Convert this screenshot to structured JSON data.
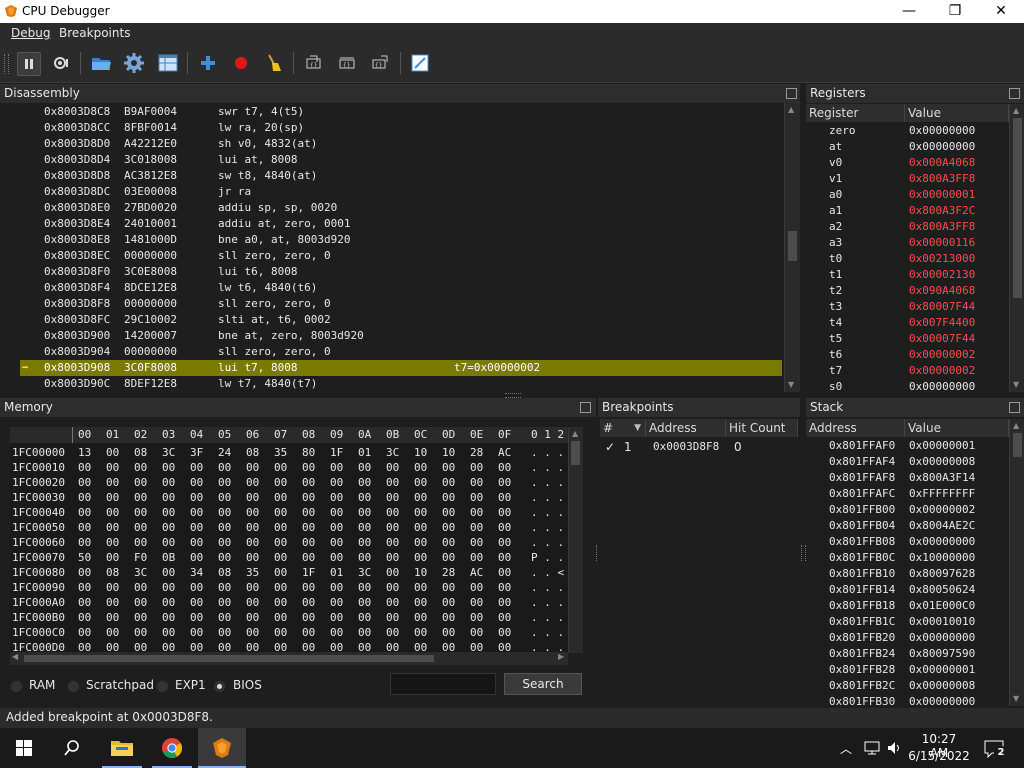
{
  "window": {
    "title": "CPU Debugger",
    "min": "—",
    "max": "❐",
    "close": "✕"
  },
  "menu": {
    "debug": "Debug",
    "breakpoints": "Breakpoints"
  },
  "disassembly": {
    "title": "Disassembly",
    "rows": [
      [
        "0x8003D8C8",
        "B9AF0004",
        "swr t7, 4(t5)",
        ""
      ],
      [
        "0x8003D8CC",
        "8FBF0014",
        "lw ra, 20(sp)",
        ""
      ],
      [
        "0x8003D8D0",
        "A42212E0",
        "sh v0, 4832(at)",
        ""
      ],
      [
        "0x8003D8D4",
        "3C018008",
        "lui at, 8008",
        ""
      ],
      [
        "0x8003D8D8",
        "AC3812E8",
        "sw t8, 4840(at)",
        ""
      ],
      [
        "0x8003D8DC",
        "03E00008",
        "jr ra",
        ""
      ],
      [
        "0x8003D8E0",
        "27BD0020",
        "addiu sp, sp, 0020",
        ""
      ],
      [
        "0x8003D8E4",
        "24010001",
        "addiu at, zero, 0001",
        ""
      ],
      [
        "0x8003D8E8",
        "1481000D",
        "bne a0, at, 8003d920",
        ""
      ],
      [
        "0x8003D8EC",
        "00000000",
        "sll zero, zero, 0",
        ""
      ],
      [
        "0x8003D8F0",
        "3C0E8008",
        "lui t6, 8008",
        ""
      ],
      [
        "0x8003D8F4",
        "8DCE12E8",
        "lw t6, 4840(t6)",
        ""
      ],
      [
        "0x8003D8F8",
        "00000000",
        "sll zero, zero, 0",
        ""
      ],
      [
        "0x8003D8FC",
        "29C10002",
        "slti at, t6, 0002",
        ""
      ],
      [
        "0x8003D900",
        "14200007",
        "bne at, zero, 8003d920",
        ""
      ],
      [
        "0x8003D904",
        "00000000",
        "sll zero, zero, 0",
        ""
      ],
      [
        "0x8003D908",
        "3C0F8008",
        "lui t7, 8008",
        "t7=0x00000002"
      ],
      [
        "0x8003D90C",
        "8DEF12E8",
        "lw t7, 4840(t7)",
        ""
      ]
    ],
    "current_index": 16
  },
  "registers": {
    "title": "Registers",
    "col_register": "Register",
    "col_value": "Value",
    "rows": [
      {
        "name": "zero",
        "value": "0x00000000",
        "changed": false
      },
      {
        "name": "at",
        "value": "0x00000000",
        "changed": false
      },
      {
        "name": "v0",
        "value": "0x000A4068",
        "changed": true
      },
      {
        "name": "v1",
        "value": "0x800A3FF8",
        "changed": true
      },
      {
        "name": "a0",
        "value": "0x00000001",
        "changed": true
      },
      {
        "name": "a1",
        "value": "0x800A3F2C",
        "changed": true
      },
      {
        "name": "a2",
        "value": "0x800A3FF8",
        "changed": true
      },
      {
        "name": "a3",
        "value": "0x00000116",
        "changed": true
      },
      {
        "name": "t0",
        "value": "0x00213000",
        "changed": true
      },
      {
        "name": "t1",
        "value": "0x00002130",
        "changed": true
      },
      {
        "name": "t2",
        "value": "0x090A4068",
        "changed": true
      },
      {
        "name": "t3",
        "value": "0x80007F44",
        "changed": true
      },
      {
        "name": "t4",
        "value": "0x007F4400",
        "changed": true
      },
      {
        "name": "t5",
        "value": "0x00007F44",
        "changed": true
      },
      {
        "name": "t6",
        "value": "0x00000002",
        "changed": true
      },
      {
        "name": "t7",
        "value": "0x00000002",
        "changed": true
      },
      {
        "name": "s0",
        "value": "0x00000000",
        "changed": false
      }
    ]
  },
  "memory": {
    "title": "Memory",
    "col_headers": [
      "00",
      "01",
      "02",
      "03",
      "04",
      "05",
      "06",
      "07",
      "08",
      "09",
      "0A",
      "0B",
      "0C",
      "0D",
      "0E",
      "0F"
    ],
    "ascii_header": "0 1 2",
    "rows": [
      {
        "addr": "1FC00000",
        "bytes": [
          "13",
          "00",
          "08",
          "3C",
          "3F",
          "24",
          "08",
          "35",
          "80",
          "1F",
          "01",
          "3C",
          "10",
          "10",
          "28",
          "AC"
        ],
        "ascii": ". . ."
      },
      {
        "addr": "1FC00010",
        "bytes": [
          "00",
          "00",
          "00",
          "00",
          "00",
          "00",
          "00",
          "00",
          "00",
          "00",
          "00",
          "00",
          "00",
          "00",
          "00",
          "00"
        ],
        "ascii": ". . ."
      },
      {
        "addr": "1FC00020",
        "bytes": [
          "00",
          "00",
          "00",
          "00",
          "00",
          "00",
          "00",
          "00",
          "00",
          "00",
          "00",
          "00",
          "00",
          "00",
          "00",
          "00"
        ],
        "ascii": ". . ."
      },
      {
        "addr": "1FC00030",
        "bytes": [
          "00",
          "00",
          "00",
          "00",
          "00",
          "00",
          "00",
          "00",
          "00",
          "00",
          "00",
          "00",
          "00",
          "00",
          "00",
          "00"
        ],
        "ascii": ". . ."
      },
      {
        "addr": "1FC00040",
        "bytes": [
          "00",
          "00",
          "00",
          "00",
          "00",
          "00",
          "00",
          "00",
          "00",
          "00",
          "00",
          "00",
          "00",
          "00",
          "00",
          "00"
        ],
        "ascii": ". . ."
      },
      {
        "addr": "1FC00050",
        "bytes": [
          "00",
          "00",
          "00",
          "00",
          "00",
          "00",
          "00",
          "00",
          "00",
          "00",
          "00",
          "00",
          "00",
          "00",
          "00",
          "00"
        ],
        "ascii": ". . ."
      },
      {
        "addr": "1FC00060",
        "bytes": [
          "00",
          "00",
          "00",
          "00",
          "00",
          "00",
          "00",
          "00",
          "00",
          "00",
          "00",
          "00",
          "00",
          "00",
          "00",
          "00"
        ],
        "ascii": ". . ."
      },
      {
        "addr": "1FC00070",
        "bytes": [
          "50",
          "00",
          "F0",
          "0B",
          "00",
          "00",
          "00",
          "00",
          "00",
          "00",
          "00",
          "00",
          "00",
          "00",
          "00",
          "00"
        ],
        "ascii": "P . ."
      },
      {
        "addr": "1FC00080",
        "bytes": [
          "00",
          "08",
          "3C",
          "00",
          "34",
          "08",
          "35",
          "00",
          "1F",
          "01",
          "3C",
          "00",
          "10",
          "28",
          "AC",
          "00"
        ],
        "ascii": ". . <"
      },
      {
        "addr": "1FC00090",
        "bytes": [
          "00",
          "00",
          "00",
          "00",
          "00",
          "00",
          "00",
          "00",
          "00",
          "00",
          "00",
          "00",
          "00",
          "00",
          "00",
          "00"
        ],
        "ascii": ". . ."
      },
      {
        "addr": "1FC000A0",
        "bytes": [
          "00",
          "00",
          "00",
          "00",
          "00",
          "00",
          "00",
          "00",
          "00",
          "00",
          "00",
          "00",
          "00",
          "00",
          "00",
          "00"
        ],
        "ascii": ". . ."
      },
      {
        "addr": "1FC000B0",
        "bytes": [
          "00",
          "00",
          "00",
          "00",
          "00",
          "00",
          "00",
          "00",
          "00",
          "00",
          "00",
          "00",
          "00",
          "00",
          "00",
          "00"
        ],
        "ascii": ". . ."
      },
      {
        "addr": "1FC000C0",
        "bytes": [
          "00",
          "00",
          "00",
          "00",
          "00",
          "00",
          "00",
          "00",
          "00",
          "00",
          "00",
          "00",
          "00",
          "00",
          "00",
          "00"
        ],
        "ascii": ". . ."
      },
      {
        "addr": "1FC000D0",
        "bytes": [
          "00",
          "00",
          "00",
          "00",
          "00",
          "00",
          "00",
          "00",
          "00",
          "00",
          "00",
          "00",
          "00",
          "00",
          "00",
          "00"
        ],
        "ascii": ". . ."
      }
    ],
    "regions": [
      "RAM",
      "Scratchpad",
      "EXP1",
      "BIOS"
    ],
    "selected_region": "BIOS",
    "search_value": "",
    "search_button": "Search"
  },
  "breakpoints": {
    "title": "Breakpoints",
    "col_num": "#",
    "col_address": "Address",
    "col_hits": "Hit Count",
    "rows": [
      {
        "check": "✓",
        "num": "1",
        "address": "0x0003D8F8",
        "hits": "0"
      }
    ]
  },
  "stack": {
    "title": "Stack",
    "col_address": "Address",
    "col_value": "Value",
    "rows": [
      [
        "0x801FFAF0",
        "0x00000001"
      ],
      [
        "0x801FFAF4",
        "0x00000008"
      ],
      [
        "0x801FFAF8",
        "0x800A3F14"
      ],
      [
        "0x801FFAFC",
        "0xFFFFFFFF"
      ],
      [
        "0x801FFB00",
        "0x00000002"
      ],
      [
        "0x801FFB04",
        "0x8004AE2C"
      ],
      [
        "0x801FFB08",
        "0x00000000"
      ],
      [
        "0x801FFB0C",
        "0x10000000"
      ],
      [
        "0x801FFB10",
        "0x80097628"
      ],
      [
        "0x801FFB14",
        "0x80050624"
      ],
      [
        "0x801FFB18",
        "0x01E000C0"
      ],
      [
        "0x801FFB1C",
        "0x00010010"
      ],
      [
        "0x801FFB20",
        "0x00000000"
      ],
      [
        "0x801FFB24",
        "0x80097590"
      ],
      [
        "0x801FFB28",
        "0x00000001"
      ],
      [
        "0x801FFB2C",
        "0x00000008"
      ],
      [
        "0x801FFB30",
        "0x00000000"
      ]
    ]
  },
  "status": "Added breakpoint at 0x0003D8F8.",
  "taskbar": {
    "time": "10:27 AM",
    "date": "6/15/2022",
    "notifications": "2"
  },
  "colors": {
    "accent": "#7a7a00",
    "changed": "#ff4a4a",
    "arrow": "#ffd84a"
  }
}
